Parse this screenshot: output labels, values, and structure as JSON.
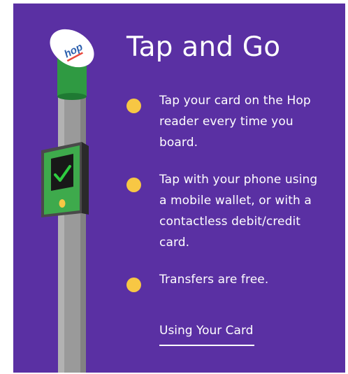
{
  "panel": {
    "title": "Tap and Go",
    "logo_text": "hop",
    "steps": [
      {
        "text": "Tap your card on the Hop reader every time you board."
      },
      {
        "text": "Tap with your phone using a mobile wallet, or with a contactless debit/credit card."
      },
      {
        "text": "Transfers are free."
      }
    ],
    "link_label": "Using Your Card"
  },
  "colors": {
    "background": "#5a30a3",
    "bullet": "#f7c744",
    "text": "#ffffff",
    "pole": "#9a9a9a",
    "reader_green": "#33a64a",
    "screen_check": "#2ecc40"
  },
  "icons": {
    "bullet": "yellow-dot",
    "reader_check": "check-icon"
  }
}
